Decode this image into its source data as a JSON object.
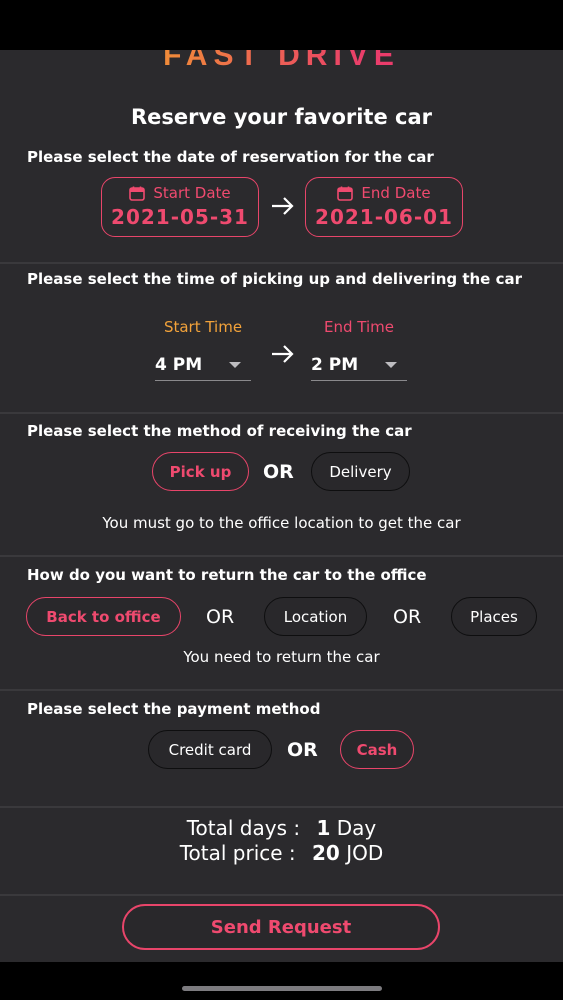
{
  "app": {
    "logo_text": "FAST DRIVE"
  },
  "page_title": "Reserve your favorite car",
  "date_section": {
    "label": "Please select the date of reservation for the car",
    "start": {
      "label": "Start Date",
      "value": "2021-05-31"
    },
    "end": {
      "label": "End Date",
      "value": "2021-06-01"
    }
  },
  "time_section": {
    "label": "Please select the time of picking up and delivering the car",
    "start": {
      "label": "Start Time",
      "value": "4 PM",
      "color": "#f2a23a"
    },
    "end": {
      "label": "End Time",
      "value": "2 PM",
      "color": "#ef4a6f"
    }
  },
  "receive_section": {
    "label": "Please select the method of receiving the car",
    "options": [
      "Pick up",
      "Delivery"
    ],
    "selected": "Pick up",
    "or_label": "OR",
    "info": "You must go to the office location to get the car"
  },
  "return_section": {
    "label": "How do you want to return the car to the office",
    "options": [
      "Back to office",
      "Location",
      "Places"
    ],
    "selected": "Back to office",
    "or_label": "OR",
    "info": "You need to return the car"
  },
  "payment_section": {
    "label": "Please select the payment method",
    "options": [
      "Credit card",
      "Cash"
    ],
    "selected": "Cash",
    "or_label": "OR"
  },
  "totals": {
    "days_label": "Total days :",
    "days_value": "1",
    "days_unit": "Day",
    "price_label": "Total price :",
    "price_value": "20",
    "price_unit": "JOD"
  },
  "send_button": "Send Request",
  "colors": {
    "accent": "#e8456a",
    "background": "#2b2a2d",
    "orange": "#f2a23a"
  }
}
